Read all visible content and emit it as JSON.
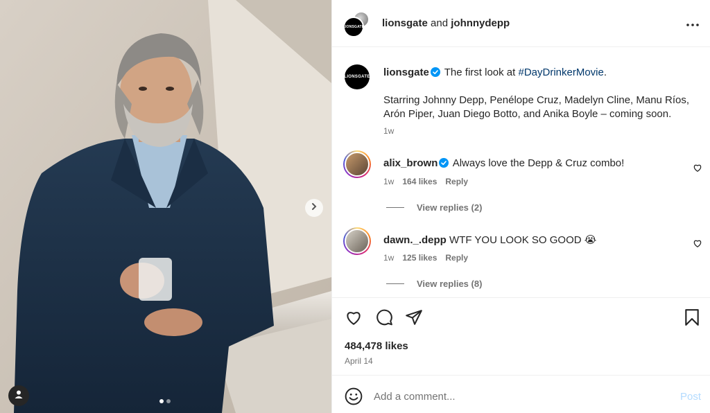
{
  "photo": {
    "carousel_dots": 2,
    "active_dot": 0,
    "next_icon": "chevron-right-icon",
    "tag_icon": "user-tag-icon"
  },
  "header": {
    "avatar_brand": "LIONSGATE",
    "user1": "lionsgate",
    "joiner": "and",
    "user2": "johnnydepp",
    "more_icon": "more-horizontal-icon"
  },
  "caption": {
    "avatar_brand": "LIONSGATE",
    "username": "lionsgate",
    "text_before_tag": "The first look at",
    "hashtag": "#DayDrinkerMovie",
    "text_after_tag": ".",
    "paragraph2": "Starring Johnny Depp, Penélope Cruz, Madelyn Cline, Manu Ríos, Arón Piper, Juan Diego Botto, and Anika Boyle – coming soon.",
    "time": "1w"
  },
  "comments": [
    {
      "username": "alix_brown",
      "verified": true,
      "text": "Always love the Depp & Cruz combo!",
      "time": "1w",
      "likes": "164 likes",
      "reply": "Reply",
      "view_replies": "View replies (2)"
    },
    {
      "username": "dawn._.depp",
      "verified": false,
      "text": "WTF YOU LOOK SO GOOD 😭",
      "time": "1w",
      "likes": "125 likes",
      "reply": "Reply",
      "view_replies": "View replies (8)"
    }
  ],
  "actions": {
    "like_icon": "heart-icon",
    "comment_icon": "comment-icon",
    "share_icon": "send-icon",
    "save_icon": "bookmark-icon",
    "likes": "484,478 likes",
    "date": "April 14"
  },
  "add_comment": {
    "emoji_icon": "emoji-icon",
    "placeholder": "Add a comment...",
    "post_label": "Post"
  },
  "colors": {
    "link": "#00376b",
    "muted": "#737373",
    "verified": "#0095f6",
    "post_disabled": "#b3dbff"
  }
}
